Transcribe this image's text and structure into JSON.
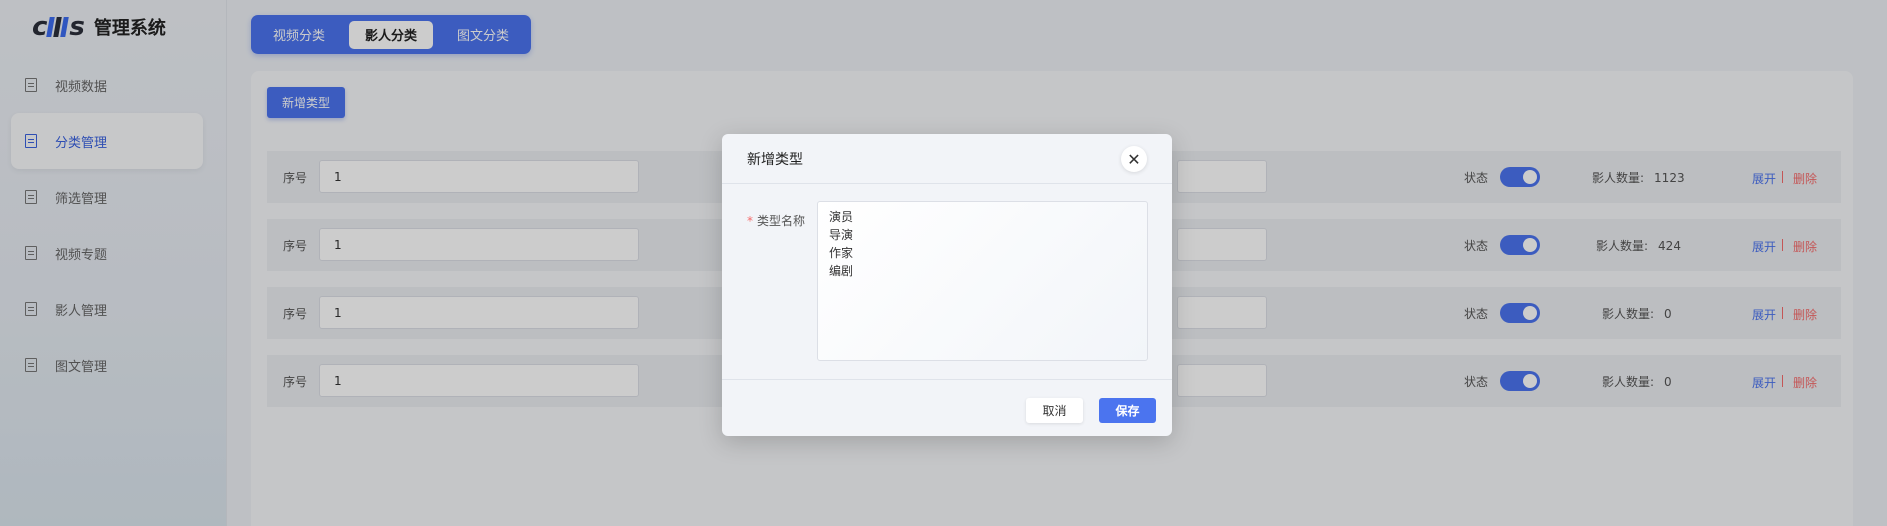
{
  "app": {
    "logo_c": "c",
    "logo_s": "s",
    "title": "管理系统",
    "brand_color": "#4b74ef"
  },
  "sidebar": {
    "items": [
      {
        "label": "视频数据",
        "icon": "document-icon",
        "active": false
      },
      {
        "label": "分类管理",
        "icon": "document-icon",
        "active": true
      },
      {
        "label": "筛选管理",
        "icon": "document-icon",
        "active": false
      },
      {
        "label": "视频专题",
        "icon": "document-icon",
        "active": false
      },
      {
        "label": "影人管理",
        "icon": "document-icon",
        "active": false
      },
      {
        "label": "图文管理",
        "icon": "document-icon",
        "active": false
      }
    ]
  },
  "tabs": [
    {
      "label": "视频分类",
      "active": false
    },
    {
      "label": "影人分类",
      "active": true
    },
    {
      "label": "图文分类",
      "active": false
    }
  ],
  "toolbar": {
    "add_label": "新增类型"
  },
  "table": {
    "seq_label": "序号",
    "status_label": "状态",
    "count_label": "影人数量:",
    "expand_label": "展开",
    "delete_label": "删除",
    "rows": [
      {
        "seq": "1",
        "status_on": true,
        "count": "1123"
      },
      {
        "seq": "1",
        "status_on": true,
        "count": "424"
      },
      {
        "seq": "1",
        "status_on": true,
        "count": "0"
      },
      {
        "seq": "1",
        "status_on": true,
        "count": "0"
      }
    ]
  },
  "dialog": {
    "title": "新增类型",
    "required_mark": "*",
    "field_label": "类型名称",
    "field_value": "演员\n导演\n作家\n编剧",
    "cancel_label": "取消",
    "save_label": "保存"
  }
}
